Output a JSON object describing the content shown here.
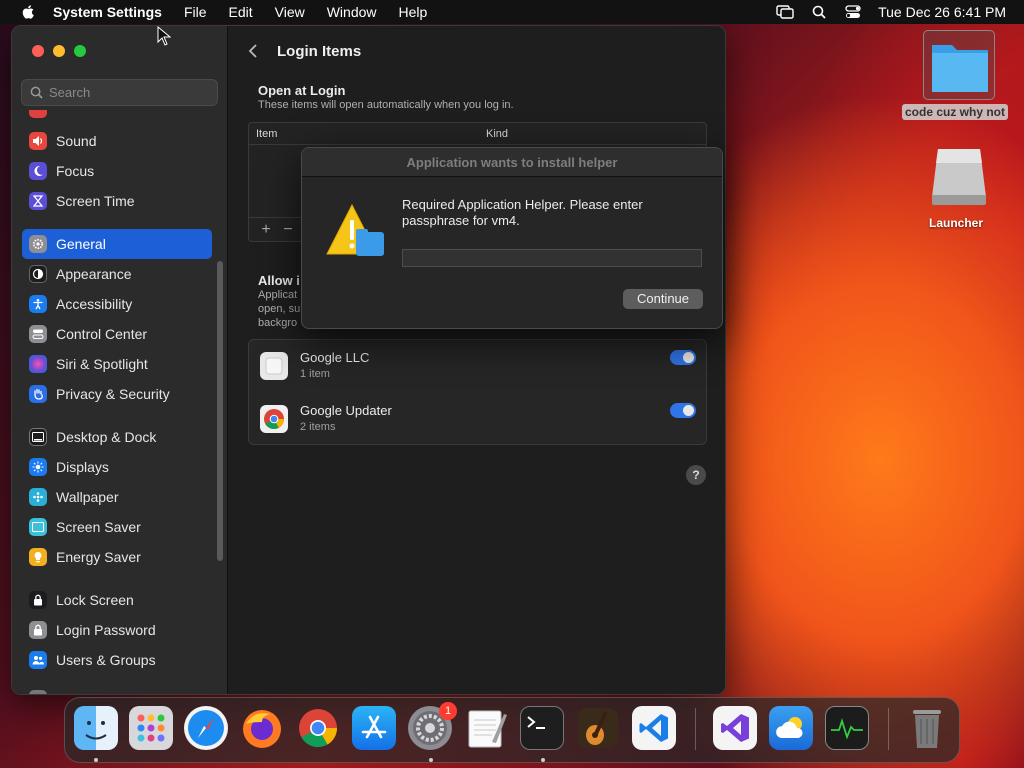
{
  "menubar": {
    "app_name": "System Settings",
    "menus": [
      "File",
      "Edit",
      "View",
      "Window",
      "Help"
    ],
    "clock": "Tue Dec 26  6:41 PM",
    "status_icons": [
      "screen-mirroring-icon",
      "spotlight-search-icon",
      "control-center-icon"
    ]
  },
  "sidebar": {
    "search_placeholder": "Search",
    "items": [
      {
        "label": "Sound",
        "icon": "speaker-icon",
        "color": "#e8473f"
      },
      {
        "label": "Focus",
        "icon": "moon-icon",
        "color": "#5b4fd8"
      },
      {
        "label": "Screen Time",
        "icon": "hourglass-icon",
        "color": "#5b4fd8"
      },
      {
        "label": "General",
        "icon": "gear-icon",
        "color": "#8e8e93",
        "active": true
      },
      {
        "label": "Appearance",
        "icon": "appearance-icon",
        "color": "#1c1c1e"
      },
      {
        "label": "Accessibility",
        "icon": "accessibility-icon",
        "color": "#1a7cf0"
      },
      {
        "label": "Control Center",
        "icon": "control-center-icon",
        "color": "#8e8e93"
      },
      {
        "label": "Siri & Spotlight",
        "icon": "siri-icon",
        "color": "#b040d8"
      },
      {
        "label": "Privacy & Security",
        "icon": "hand-icon",
        "color": "#2a6ee8"
      },
      {
        "label": "Desktop & Dock",
        "icon": "dock-icon",
        "color": "#1c1c1e"
      },
      {
        "label": "Displays",
        "icon": "sun-icon",
        "color": "#1a7cf0"
      },
      {
        "label": "Wallpaper",
        "icon": "wallpaper-icon",
        "color": "#2ab0d8"
      },
      {
        "label": "Screen Saver",
        "icon": "screen-saver-icon",
        "color": "#3ac0d8"
      },
      {
        "label": "Energy Saver",
        "icon": "lightbulb-icon",
        "color": "#f0b020"
      },
      {
        "label": "Lock Screen",
        "icon": "lock-icon",
        "color": "#1c1c1e"
      },
      {
        "label": "Login Password",
        "icon": "padlock-icon",
        "color": "#8e8e93"
      },
      {
        "label": "Users & Groups",
        "icon": "users-icon",
        "color": "#1a7cf0"
      }
    ]
  },
  "main": {
    "title": "Login Items",
    "open_at_login": {
      "heading": "Open at Login",
      "subtitle": "These items will open automatically when you log in.",
      "columns": [
        "Item",
        "Kind"
      ],
      "add_label": "+",
      "remove_label": "−"
    },
    "allow_background": {
      "heading_partial": "Allow i",
      "subtitle_lines": [
        "Applicat",
        "open, su",
        "backgro"
      ]
    },
    "background_items": [
      {
        "name": "Google LLC",
        "detail": "1 item",
        "enabled": true,
        "icon": "google-llc-icon"
      },
      {
        "name": "Google Updater",
        "detail": "2 items",
        "enabled": true,
        "icon": "chrome-icon"
      }
    ],
    "help_label": "?"
  },
  "dialog": {
    "title": "Application wants to install helper",
    "message": "Required Application Helper. Please enter passphrase for vm4.",
    "input_value": "",
    "button_label": "Continue"
  },
  "desktop": {
    "folder_label": "code cuz why not",
    "drive_label": "Launcher"
  },
  "dock": {
    "apps": [
      "Finder",
      "Launchpad",
      "Safari",
      "Firefox",
      "Google Chrome",
      "App Store",
      "System Settings",
      "TextEdit",
      "Terminal",
      "GarageBand",
      "Visual Studio Code",
      "Visual Studio",
      "Weather",
      "Activity Monitor",
      "Trash"
    ],
    "settings_badge": "1"
  }
}
